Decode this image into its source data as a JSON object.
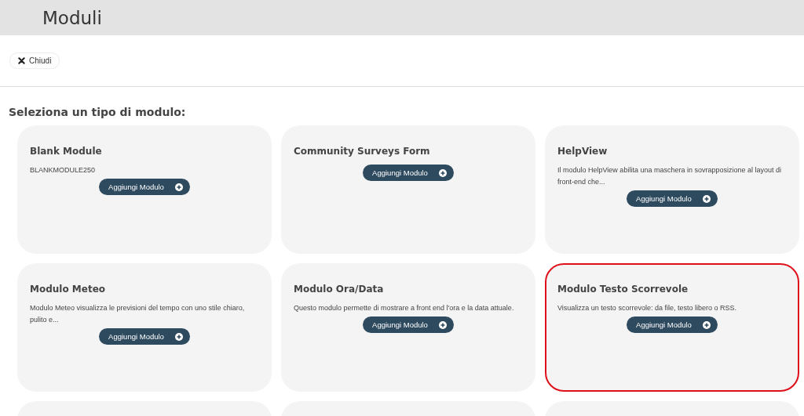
{
  "header": {
    "title": "Moduli"
  },
  "close_button": {
    "label": "Chiudi"
  },
  "section_heading": "Seleziona un tipo di modulo:",
  "modules": [
    {
      "kind": "module",
      "title": "Blank Module",
      "description": "BLANKMODULE250",
      "button": "Aggiungi Modulo",
      "highlighted": false
    },
    {
      "kind": "module",
      "title": "Community Surveys Form",
      "button": "Aggiungi Modulo",
      "highlighted": false
    },
    {
      "kind": "module",
      "title": "HelpView",
      "description": "Il modulo HelpView abilita una maschera in sovrapposizione al layout di front-end che...",
      "button": "Aggiungi Modulo",
      "highlighted": false
    },
    {
      "kind": "module",
      "title": "Modulo Meteo",
      "description": "Modulo Meteo visualizza le previsioni del tempo con uno stile chiaro, pulito e...",
      "button": "Aggiungi Modulo",
      "highlighted": false
    },
    {
      "kind": "module",
      "title": "Modulo Ora/Data",
      "description": "Questo modulo permette di mostrare a front end l'ora e la data attuale.",
      "button": "Aggiungi Modulo",
      "highlighted": false
    },
    {
      "kind": "module",
      "title": "Modulo Testo Scorrevole",
      "description": "Visualizza un testo scorrevole: da file, testo libero o RSS.",
      "button": "Aggiungi Modulo",
      "highlighted": true
    },
    {
      "kind": "partial"
    },
    {
      "kind": "partial"
    },
    {
      "kind": "partial"
    }
  ]
}
